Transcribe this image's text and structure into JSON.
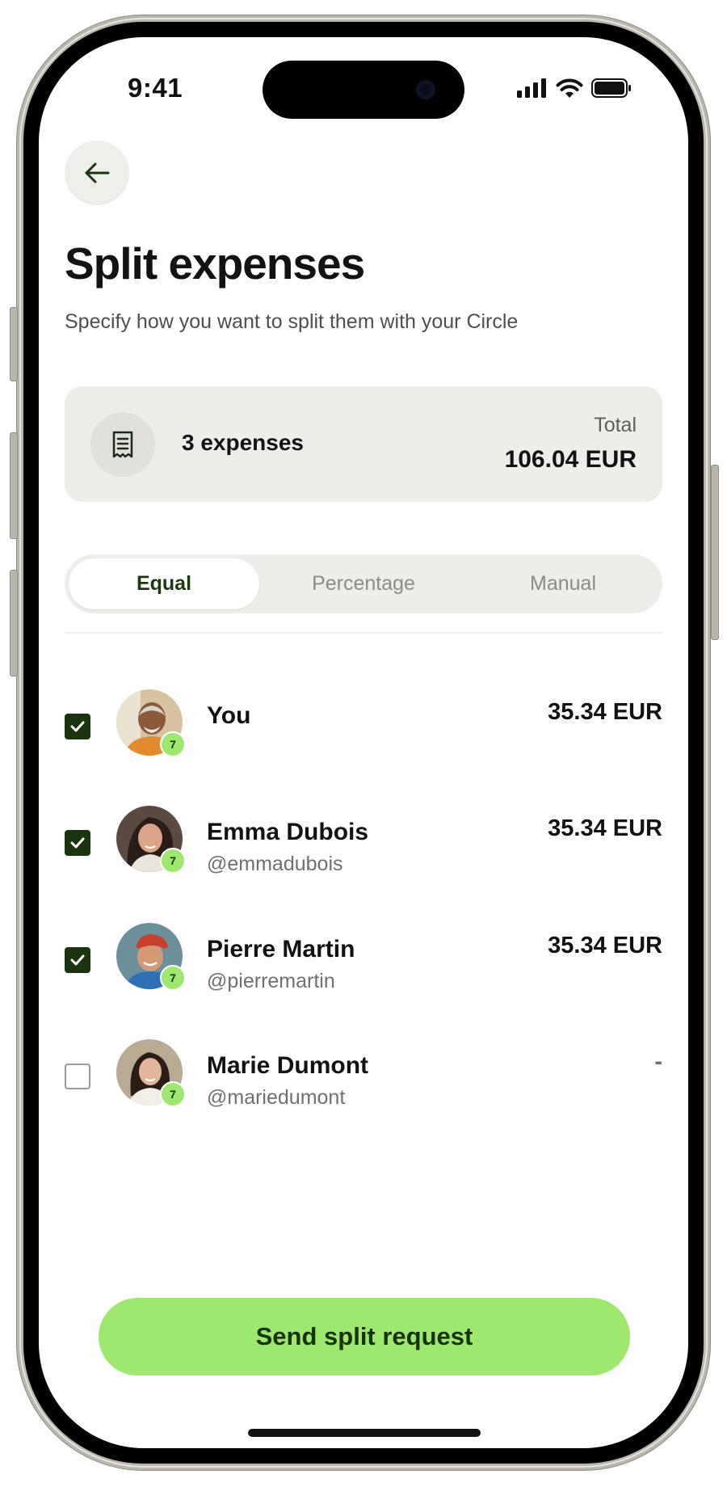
{
  "status_bar": {
    "time": "9:41"
  },
  "header": {
    "title": "Split expenses",
    "subtitle": "Specify how you want to split them with your Circle"
  },
  "summary": {
    "expenses_label": "3 expenses",
    "total_label": "Total",
    "total_value": "106.04 EUR"
  },
  "split_modes": {
    "tabs": [
      {
        "label": "Equal",
        "selected": true
      },
      {
        "label": "Percentage",
        "selected": false
      },
      {
        "label": "Manual",
        "selected": false
      }
    ]
  },
  "participants": [
    {
      "name": "You",
      "handle": "",
      "amount": "35.34 EUR",
      "checked": true
    },
    {
      "name": "Emma Dubois",
      "handle": "@emmadubois",
      "amount": "35.34 EUR",
      "checked": true
    },
    {
      "name": "Pierre Martin",
      "handle": "@pierremartin",
      "amount": "35.34 EUR",
      "checked": true
    },
    {
      "name": "Marie Dumont",
      "handle": "@mariedumont",
      "amount": "-",
      "checked": false
    }
  ],
  "actions": {
    "send_label": "Send split request"
  },
  "icons": {
    "back": "arrow-left-icon",
    "receipt": "receipt-icon",
    "check": "check-icon",
    "badge": "wise-badge-icon"
  },
  "colors": {
    "accent": "#9fe870",
    "accent_text": "#163300",
    "checkbox_checked": "#1a3410",
    "card_bg": "#edeee9"
  }
}
